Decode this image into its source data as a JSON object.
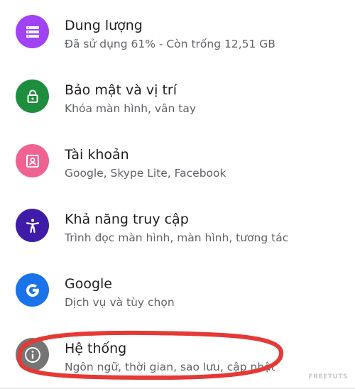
{
  "settings": {
    "items": [
      {
        "key": "storage",
        "title": "Dung lượng",
        "subtitle": "Đã sử dụng 61% - Còn trống 12,51 GB",
        "icon": "storage-icon",
        "color": "#a142f4"
      },
      {
        "key": "security",
        "title": "Bảo mật và vị trí",
        "subtitle": "Khóa màn hình, vân tay",
        "icon": "lock-icon",
        "color": "#1e8e3e"
      },
      {
        "key": "accounts",
        "title": "Tài khoản",
        "subtitle": "Google, Skype Lite, Facebook",
        "icon": "account-box-icon",
        "color": "#f06292"
      },
      {
        "key": "accessibility",
        "title": "Khả năng truy cập",
        "subtitle": "Trình đọc màn hình, màn hình, tương tác",
        "icon": "accessibility-icon",
        "color": "#3f1ca8"
      },
      {
        "key": "google",
        "title": "Google",
        "subtitle": "Dịch vụ và tùy chọn",
        "icon": "google-g-icon",
        "color": "#1a73e8"
      },
      {
        "key": "system",
        "title": "Hệ thống",
        "subtitle": "Ngôn ngữ, thời gian, sao lưu, cập nhật",
        "icon": "info-icon",
        "color": "#757575"
      }
    ]
  },
  "annotation": {
    "color": "#e53935"
  },
  "watermark": {
    "text": "FREETUTS"
  }
}
